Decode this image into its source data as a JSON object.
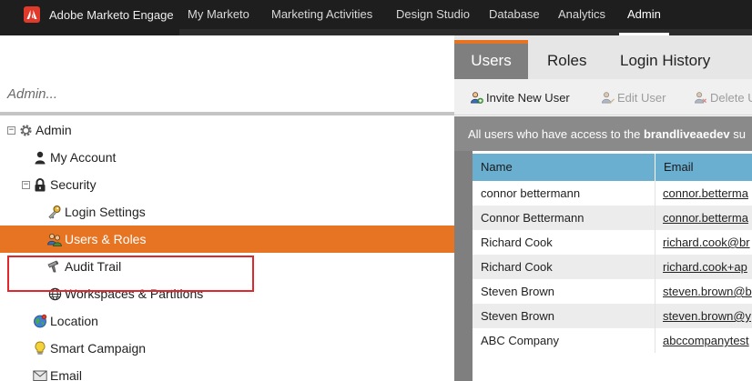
{
  "app": {
    "brand": "Adobe Marketo Engage",
    "nav_tabs": [
      "My Marketo",
      "Marketing Activities",
      "Design Studio",
      "Database",
      "Analytics",
      "Admin"
    ],
    "active_nav": "Admin"
  },
  "left_panel": {
    "search_placeholder": "Admin...",
    "tree": [
      {
        "label": "Admin",
        "icon": "gear-icon",
        "expander": "−",
        "selected": false
      },
      {
        "label": "My Account",
        "icon": "person-icon",
        "selected": false
      },
      {
        "label": "Security",
        "icon": "lock-icon",
        "expander": "−",
        "selected": false
      },
      {
        "label": "Login Settings",
        "icon": "key-icon",
        "selected": false
      },
      {
        "label": "Users & Roles",
        "icon": "users-icon",
        "selected": true
      },
      {
        "label": "Audit Trail",
        "icon": "audit-icon",
        "selected": false
      },
      {
        "label": "Workspaces & Partitions",
        "icon": "globe-icon",
        "selected": false
      },
      {
        "label": "Location",
        "icon": "location-globe-icon",
        "selected": false
      },
      {
        "label": "Smart Campaign",
        "icon": "lightbulb-icon",
        "selected": false
      },
      {
        "label": "Email",
        "icon": "email-icon",
        "selected": false
      }
    ]
  },
  "right_panel": {
    "tabs": [
      "Users",
      "Roles",
      "Login History"
    ],
    "active_tab": "Users",
    "toolbar": {
      "invite": "Invite New User",
      "edit": "Edit User",
      "delete": "Delete U"
    },
    "info_prefix": "All users who have access to the ",
    "info_bold": "brandliveaedev",
    "info_suffix": " su",
    "columns": [
      "Name",
      "Email"
    ],
    "rows": [
      {
        "name": "connor bettermann",
        "email": "connor.betterma"
      },
      {
        "name": "Connor Bettermann",
        "email": "connor.betterma"
      },
      {
        "name": "Richard Cook",
        "email": "richard.cook@br"
      },
      {
        "name": "Richard Cook",
        "email": "richard.cook+ap"
      },
      {
        "name": "Steven Brown",
        "email": "steven.brown@b"
      },
      {
        "name": "Steven Brown",
        "email": "steven.brown@y"
      },
      {
        "name": "ABC Company",
        "email": "abccompanytest"
      }
    ]
  },
  "colors": {
    "accent_orange": "#e77423",
    "grid_header": "#6aaed0",
    "nav_bg": "#1e1e1e",
    "highlight_red": "#e0272b"
  }
}
